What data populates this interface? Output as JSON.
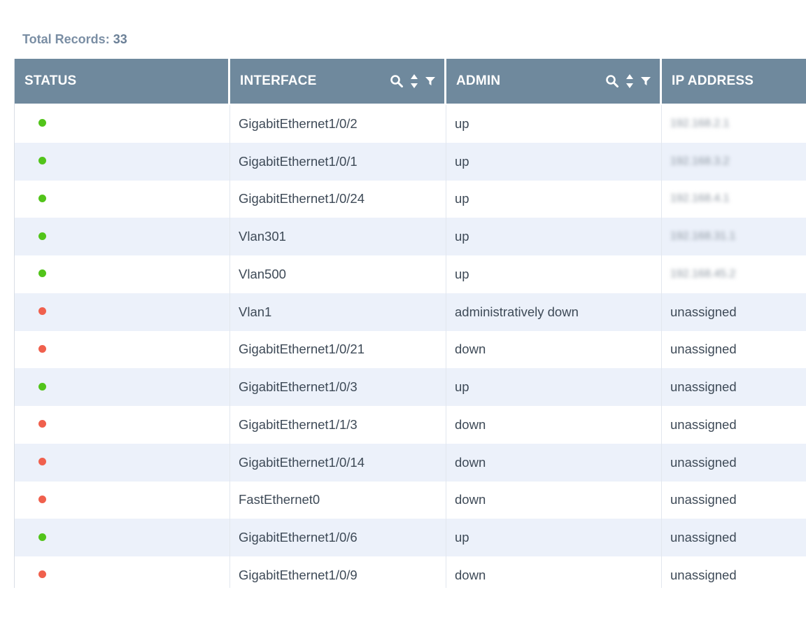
{
  "summary": {
    "label": "Total Records:",
    "count": "33"
  },
  "colors": {
    "header_bg": "#6f899d",
    "status_up": "#52c41a",
    "status_down": "#f0604d",
    "row_alt": "#ecf1fa"
  },
  "columns": [
    {
      "key": "status",
      "label": "STATUS",
      "icons": []
    },
    {
      "key": "interface",
      "label": "INTERFACE",
      "icons": [
        "search-icon",
        "sort-icon",
        "filter-icon"
      ]
    },
    {
      "key": "admin",
      "label": "ADMIN",
      "icons": [
        "search-icon",
        "sort-icon",
        "filter-icon"
      ]
    },
    {
      "key": "ip",
      "label": "IP ADDRESS",
      "icons": []
    }
  ],
  "rows": [
    {
      "status": "up",
      "interface": "GigabitEthernet1/0/2",
      "admin": "up",
      "ip": "192.168.2.1",
      "ip_blurred": true
    },
    {
      "status": "up",
      "interface": "GigabitEthernet1/0/1",
      "admin": "up",
      "ip": "192.168.3.2",
      "ip_blurred": true
    },
    {
      "status": "up",
      "interface": "GigabitEthernet1/0/24",
      "admin": "up",
      "ip": "192.168.4.1",
      "ip_blurred": true
    },
    {
      "status": "up",
      "interface": "Vlan301",
      "admin": "up",
      "ip": "192.168.31.1",
      "ip_blurred": true
    },
    {
      "status": "up",
      "interface": "Vlan500",
      "admin": "up",
      "ip": "192.168.45.2",
      "ip_blurred": true
    },
    {
      "status": "down",
      "interface": "Vlan1",
      "admin": "administratively down",
      "ip": "unassigned",
      "ip_blurred": false
    },
    {
      "status": "down",
      "interface": "GigabitEthernet1/0/21",
      "admin": "down",
      "ip": "unassigned",
      "ip_blurred": false
    },
    {
      "status": "up",
      "interface": "GigabitEthernet1/0/3",
      "admin": "up",
      "ip": "unassigned",
      "ip_blurred": false
    },
    {
      "status": "down",
      "interface": "GigabitEthernet1/1/3",
      "admin": "down",
      "ip": "unassigned",
      "ip_blurred": false
    },
    {
      "status": "down",
      "interface": "GigabitEthernet1/0/14",
      "admin": "down",
      "ip": "unassigned",
      "ip_blurred": false
    },
    {
      "status": "down",
      "interface": "FastEthernet0",
      "admin": "down",
      "ip": "unassigned",
      "ip_blurred": false
    },
    {
      "status": "up",
      "interface": "GigabitEthernet1/0/6",
      "admin": "up",
      "ip": "unassigned",
      "ip_blurred": false
    },
    {
      "status": "down",
      "interface": "GigabitEthernet1/0/9",
      "admin": "down",
      "ip": "unassigned",
      "ip_blurred": false
    }
  ]
}
